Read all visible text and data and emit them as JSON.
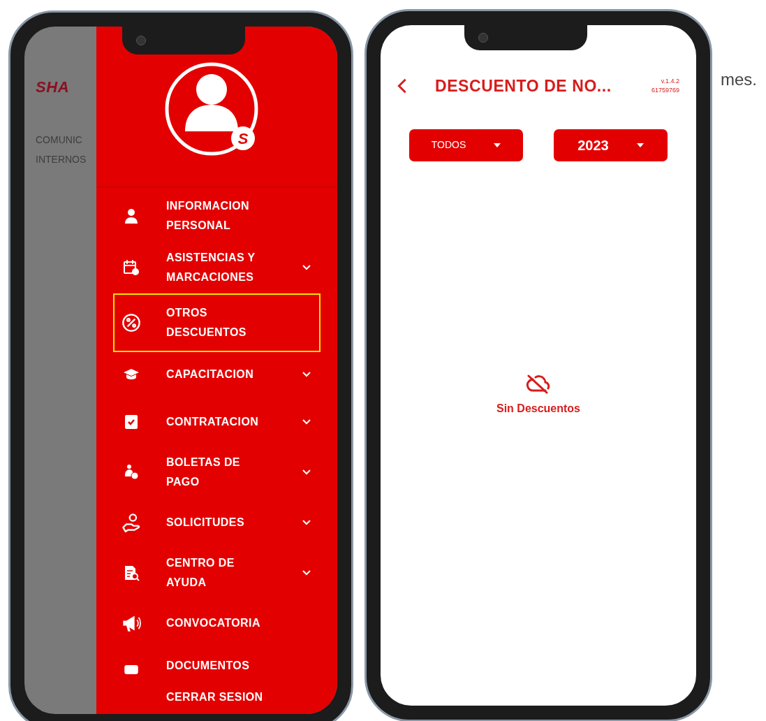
{
  "left_phone": {
    "background_screen": {
      "logo": "SHA",
      "lines": [
        "COMUNIC",
        "INTERNOS"
      ]
    },
    "drawer": {
      "avatar_badge": "S",
      "items": [
        {
          "label": "INFORMACION PERSONAL",
          "expandable": false,
          "highlighted": false
        },
        {
          "label": "ASISTENCIAS Y MARCACIONES",
          "expandable": true,
          "highlighted": false
        },
        {
          "label": "OTROS DESCUENTOS",
          "expandable": false,
          "highlighted": true
        },
        {
          "label": "CAPACITACION",
          "expandable": true,
          "highlighted": false
        },
        {
          "label": "CONTRATACION",
          "expandable": true,
          "highlighted": false
        },
        {
          "label": "BOLETAS DE PAGO",
          "expandable": true,
          "highlighted": false
        },
        {
          "label": "SOLICITUDES",
          "expandable": true,
          "highlighted": false
        },
        {
          "label": "CENTRO DE AYUDA",
          "expandable": true,
          "highlighted": false
        },
        {
          "label": "CONVOCATORIA",
          "expandable": false,
          "highlighted": false
        },
        {
          "label": "DOCUMENTOS",
          "expandable": false,
          "highlighted": false
        },
        {
          "label": "CERRAR SESION",
          "expandable": false,
          "highlighted": false
        }
      ]
    }
  },
  "right_phone": {
    "header": {
      "title": "DESCUENTO DE NO...",
      "version": "v.1.4.2",
      "code": "61759769"
    },
    "filters": [
      {
        "value": "TODOS"
      },
      {
        "value": "2023"
      }
    ],
    "empty_state": {
      "message": "Sin Descuentos"
    }
  },
  "side_text": "mes."
}
